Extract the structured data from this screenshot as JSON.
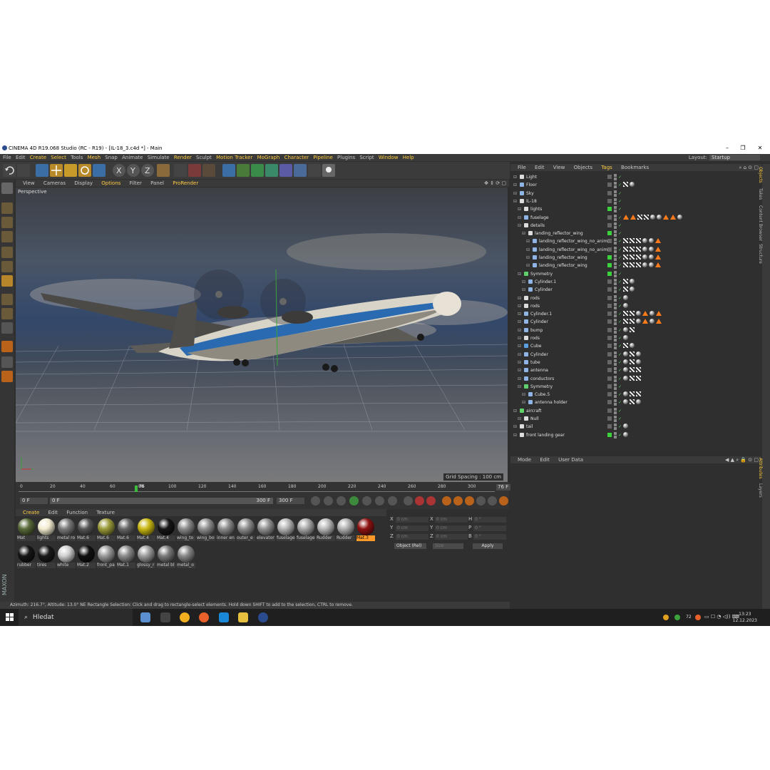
{
  "window": {
    "title": "CINEMA 4D R19.068 Studio (RC - R19) - [IL-18_3.c4d *] - Main",
    "min": "–",
    "max": "❐",
    "close": "✕"
  },
  "menu": [
    "File",
    "Edit",
    "Create",
    "Select",
    "Tools",
    "Mesh",
    "Snap",
    "Animate",
    "Simulate",
    "Render",
    "Sculpt",
    "Motion Tracker",
    "MoGraph",
    "Character",
    "Pipeline",
    "Plugins",
    "Script",
    "Window",
    "Help"
  ],
  "layout": {
    "label": "Layout:",
    "value": "Startup"
  },
  "viewport": {
    "menu": [
      "View",
      "Cameras",
      "Display",
      "Options",
      "Filter",
      "Panel",
      "ProRender"
    ],
    "camera_label": "Perspective",
    "grid_spacing": "Grid Spacing : 100 cm"
  },
  "timeline": {
    "ticks": [
      "0",
      "20",
      "40",
      "60",
      "80",
      "100",
      "120",
      "140",
      "160",
      "180",
      "200",
      "220",
      "240",
      "260",
      "280",
      "300"
    ],
    "current_frame": "76",
    "frame_field": "76 F",
    "start": "0 F",
    "range_start": "0 F",
    "range_end": "300 F",
    "end": "300 F"
  },
  "materials": {
    "menu": [
      "Create",
      "Edit",
      "Function",
      "Texture"
    ],
    "row1": [
      {
        "name": "Mat",
        "color": "#5a6b3a"
      },
      {
        "name": "lights",
        "color": "#f2ecd0"
      },
      {
        "name": "metal ro",
        "color": "#7a7a7a"
      },
      {
        "name": "Mat.6",
        "color": "#555555"
      },
      {
        "name": "Mat.6",
        "color": "#9a9a3a"
      },
      {
        "name": "Mat.6",
        "color": "#666666"
      },
      {
        "name": "Mat.4",
        "color": "#c9b814"
      },
      {
        "name": "Mat.4",
        "color": "#151515"
      },
      {
        "name": "wing_to",
        "color": "#8a8a8a"
      },
      {
        "name": "wing_bo",
        "color": "#909090"
      },
      {
        "name": "inner en",
        "color": "#8c8c8c"
      },
      {
        "name": "outer_e",
        "color": "#8e8e8e"
      },
      {
        "name": "elevator",
        "color": "#929292"
      },
      {
        "name": "fuselage",
        "color": "#b5b5b5"
      },
      {
        "name": "fuselage",
        "color": "#a8a8a8"
      },
      {
        "name": "Rudder",
        "color": "#b8b8b8"
      },
      {
        "name": "Rudder",
        "color": "#b0b0b0"
      },
      {
        "name": "Mat.3",
        "color": "#8e1212"
      }
    ],
    "row2": [
      {
        "name": "rubber",
        "color": "#151515"
      },
      {
        "name": "tires",
        "color": "#1a1a1a"
      },
      {
        "name": "white",
        "color": "#cfcfcf"
      },
      {
        "name": "Mat.2",
        "color": "#101010"
      },
      {
        "name": "front_pa",
        "color": "#9a9a9a"
      },
      {
        "name": "Mat.1",
        "color": "#8a8a8a"
      },
      {
        "name": "glossy_r",
        "color": "#9c9c9c"
      },
      {
        "name": "metal bl",
        "color": "#7a7a7a"
      },
      {
        "name": "metal_o",
        "color": "#888888"
      }
    ],
    "selected_index": 17
  },
  "coords": {
    "rows": [
      {
        "a": "X",
        "av": "0 cm",
        "b": "X",
        "bv": "0 cm",
        "c": "H",
        "cv": "0 °"
      },
      {
        "a": "Y",
        "av": "0 cm",
        "b": "Y",
        "bv": "0 cm",
        "c": "P",
        "cv": "0 °"
      },
      {
        "a": "Z",
        "av": "0 cm",
        "b": "Z",
        "bv": "0 cm",
        "c": "B",
        "cv": "0 °"
      }
    ],
    "mode": "Object (Rel)",
    "size": "Size",
    "apply": "Apply"
  },
  "status": "Azimuth: 216.7°, Altitude: 13.0°  NE      Rectangle Selection: Click and drag to rectangle-select elements. Hold down SHIFT to add to the selection, CTRL to remove.",
  "objects": {
    "menu": [
      "File",
      "Edit",
      "View",
      "Objects",
      "Tags",
      "Bookmarks"
    ],
    "rows": [
      {
        "name": "Light",
        "indent": 0,
        "icon": "#dddddd",
        "green": false,
        "tags": []
      },
      {
        "name": "Floor",
        "indent": 0,
        "icon": "#8fb5e6",
        "green": false,
        "tags": [
          "chk",
          "ball"
        ]
      },
      {
        "name": "Sky",
        "indent": 0,
        "icon": "#8fb5e6",
        "green": false,
        "tags": []
      },
      {
        "name": "IL-18",
        "indent": 0,
        "icon": "#dddddd",
        "green": false,
        "tags": []
      },
      {
        "name": "lights",
        "indent": 1,
        "icon": "#dddddd",
        "green": true,
        "tags": []
      },
      {
        "name": "fuselage",
        "indent": 1,
        "icon": "#8fb5e6",
        "green": false,
        "tags": [
          "tri",
          "tri",
          "chk",
          "chk",
          "ball",
          "ball",
          "tri",
          "tri",
          "ball"
        ]
      },
      {
        "name": "details",
        "indent": 1,
        "icon": "#dddddd",
        "green": false,
        "tags": []
      },
      {
        "name": "landing_reflector_wing",
        "indent": 2,
        "icon": "#dddddd",
        "green": true,
        "tags": []
      },
      {
        "name": "landing_reflector_wing_no_anim",
        "indent": 3,
        "icon": "#8fb5e6",
        "green": false,
        "tags": [
          "chk",
          "chk",
          "chk",
          "ball",
          "ball",
          "tri"
        ]
      },
      {
        "name": "landing_reflector_wing_no_anim",
        "indent": 3,
        "icon": "#8fb5e6",
        "green": false,
        "tags": [
          "chk",
          "chk",
          "chk",
          "ball",
          "ball",
          "tri"
        ]
      },
      {
        "name": "landing_reflector_wing",
        "indent": 3,
        "icon": "#8fb5e6",
        "green": true,
        "tags": [
          "chk",
          "chk",
          "chk",
          "ball",
          "ball",
          "tri"
        ]
      },
      {
        "name": "landing_reflector_wing",
        "indent": 3,
        "icon": "#8fb5e6",
        "green": true,
        "tags": [
          "chk",
          "chk",
          "chk",
          "ball",
          "ball",
          "tri"
        ]
      },
      {
        "name": "Symmetry",
        "indent": 1,
        "icon": "#5fd06a",
        "green": true,
        "tags": []
      },
      {
        "name": "Cylinder.1",
        "indent": 2,
        "icon": "#8fb5e6",
        "green": false,
        "tags": [
          "chk",
          "ball"
        ]
      },
      {
        "name": "Cylinder",
        "indent": 2,
        "icon": "#8fb5e6",
        "green": false,
        "tags": [
          "chk",
          "ball"
        ]
      },
      {
        "name": "rods",
        "indent": 1,
        "icon": "#dddddd",
        "green": false,
        "tags": [
          "ball"
        ]
      },
      {
        "name": "rods",
        "indent": 1,
        "icon": "#dddddd",
        "green": false,
        "tags": [
          "ball"
        ]
      },
      {
        "name": "Cylinder.1",
        "indent": 1,
        "icon": "#8fb5e6",
        "green": false,
        "tags": [
          "chk",
          "chk",
          "ball",
          "tri",
          "ball",
          "tri"
        ]
      },
      {
        "name": "Cylinder",
        "indent": 1,
        "icon": "#8fb5e6",
        "green": false,
        "tags": [
          "chk",
          "chk",
          "ball",
          "tri",
          "ball",
          "tri"
        ]
      },
      {
        "name": "bump",
        "indent": 1,
        "icon": "#8fb5e6",
        "green": false,
        "tags": [
          "ball",
          "chk"
        ]
      },
      {
        "name": "rods",
        "indent": 1,
        "icon": "#dddddd",
        "green": false,
        "tags": [
          "ball"
        ]
      },
      {
        "name": "Cube",
        "indent": 1,
        "icon": "#5aa0e0",
        "green": false,
        "tags": [
          "chk",
          "ball"
        ]
      },
      {
        "name": "Cylinder",
        "indent": 1,
        "icon": "#8fb5e6",
        "green": false,
        "tags": [
          "ball",
          "chk",
          "ball"
        ]
      },
      {
        "name": "tube",
        "indent": 1,
        "icon": "#8fb5e6",
        "green": false,
        "tags": [
          "ball",
          "chk",
          "ball"
        ]
      },
      {
        "name": "antenna",
        "indent": 1,
        "icon": "#8fb5e6",
        "green": false,
        "tags": [
          "ball",
          "chk",
          "chk"
        ]
      },
      {
        "name": "conductors",
        "indent": 1,
        "icon": "#8fb5e6",
        "green": false,
        "tags": [
          "ball",
          "chk",
          "chk"
        ]
      },
      {
        "name": "Symmetry",
        "indent": 1,
        "icon": "#5fd06a",
        "green": false,
        "tags": []
      },
      {
        "name": "Cube.5",
        "indent": 2,
        "icon": "#8fb5e6",
        "green": false,
        "tags": [
          "ball",
          "chk",
          "chk"
        ]
      },
      {
        "name": "antenna holder",
        "indent": 2,
        "icon": "#8fb5e6",
        "green": false,
        "tags": [
          "ball",
          "chk",
          "ball"
        ]
      },
      {
        "name": "aircraft",
        "indent": 0,
        "icon": "#5fd06a",
        "green": false,
        "tags": []
      },
      {
        "name": "Null",
        "indent": 1,
        "icon": "#dddddd",
        "green": false,
        "tags": []
      },
      {
        "name": "tail",
        "indent": 0,
        "icon": "#dddddd",
        "green": false,
        "tags": [
          "ball"
        ]
      },
      {
        "name": "front landing gear",
        "indent": 0,
        "icon": "#dddddd",
        "green": true,
        "tags": [
          "ball"
        ]
      }
    ]
  },
  "attributes": {
    "menu": [
      "Mode",
      "Edit",
      "User Data"
    ]
  },
  "side_tabs": [
    "Objects",
    "Takes",
    "Content Browser",
    "Structure",
    "Attributes",
    "Layers"
  ],
  "taskbar": {
    "search": "Hledat",
    "time": "13:23",
    "date": "12.12.2023",
    "temp": "72"
  },
  "colors": {
    "accent": "#ffcc44",
    "selected": "#ff9a2a",
    "green_flag": "#3dd13d"
  }
}
